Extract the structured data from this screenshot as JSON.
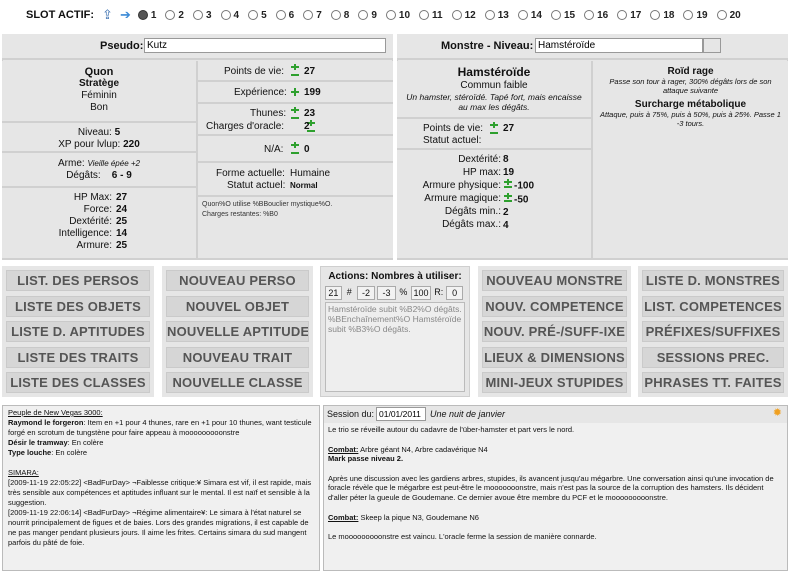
{
  "slotbar": {
    "label": "SLOT ACTIF:",
    "upload_icon": "upload-icon",
    "next_icon": "arrow-right-icon",
    "slots": [
      "1",
      "2",
      "3",
      "4",
      "5",
      "6",
      "7",
      "8",
      "9",
      "10",
      "11",
      "12",
      "13",
      "14",
      "15",
      "16",
      "17",
      "18",
      "19",
      "20"
    ],
    "active_slot": "1"
  },
  "player": {
    "pseudo_label": "Pseudo:",
    "pseudo_value": "Kutz",
    "name": "Quon",
    "class": "Stratège",
    "gender": "Féminin",
    "alignment": "Bon",
    "niveau_label": "Niveau:",
    "niveau": "5",
    "xp_label": "XP pour lvlup:",
    "xp": "220",
    "arme_label": "Arme:",
    "arme": "Vieille épée +2",
    "degats_label": "Dégâts:",
    "degats": "6 - 9",
    "hpmax_label": "HP Max:",
    "hpmax": "27",
    "force_label": "Force:",
    "force": "24",
    "dexterite_label": "Dextérité:",
    "dexterite": "25",
    "intelligence_label": "Intelligence:",
    "intelligence": "14",
    "armure_label": "Armure:",
    "armure": "25",
    "pv_label": "Points de vie:",
    "pv": "27",
    "exp_label": "Expérience:",
    "exp": "199",
    "thunes_label": "Thunes:",
    "thunes": "23",
    "charges_label": "Charges d'oracle:",
    "charges": "2",
    "na_label": "N/A:",
    "na": "0",
    "forme_label": "Forme actuelle:",
    "forme": "Humaine",
    "statut_label": "Statut actuel:",
    "statut": "Normal",
    "note1": "Quon%O utilise %BBouclier mystique%O.",
    "note2": "Charges restantes: %B0"
  },
  "monster": {
    "label": "Monstre - Niveau:",
    "value": "Hamstéroïde",
    "name": "Hamstéroïde",
    "rank": "Commun faible",
    "desc": "Un hamster, stéroïdé. Tapé fort, mais encaisse au max les dégâts.",
    "pv_label": "Points de vie:",
    "pv": "27",
    "statut_label": "Statut actuel:",
    "dexterite_label": "Dextérité:",
    "dexterite": "8",
    "hpmax_label": "HP max:",
    "hpmax": "19",
    "armphys_label": "Armure physique:",
    "armphys": "-100",
    "armmag_label": "Armure magique:",
    "armmag": "-50",
    "degmin_label": "Dégâts min.:",
    "degmin": "2",
    "degmax_label": "Dégâts max.:",
    "degmax": "4",
    "skill1_title": "Roïd rage",
    "skill1_desc": "Passe son tour à rager, 300% dégâts lors de son attaque suivante",
    "skill2_title": "Surcharge métabolique",
    "skill2_desc": "Attaque, puis à 75%, puis à 50%, puis à 25%. Passe 1 -3 tours."
  },
  "nav": {
    "col1": [
      "LIST. DES PERSOS",
      "LISTE DES OBJETS",
      "LISTE D. APTITUDES",
      "LISTE DES TRAITS",
      "LISTE DES CLASSES"
    ],
    "col2": [
      "NOUVEAU PERSO",
      "NOUVEL OBJET",
      "NOUVELLE APTITUDE",
      "NOUVEAU TRAIT",
      "NOUVELLE CLASSE"
    ],
    "col4": [
      "NOUVEAU MONSTRE",
      "NOUV. COMPETENCE",
      "NOUV. PRÉ-/SUFF-IXE",
      "LIEUX & DIMENSIONS",
      "MINI-JEUX STUPIDES"
    ],
    "col5": [
      "LISTE D. MONSTRES",
      "LIST. COMPETENCES",
      "PRÉFIXES/SUFFIXES",
      "SESSIONS PREC.",
      "PHRASES TT. FAITES"
    ]
  },
  "actions": {
    "title": "Actions: Nombres à utiliser:",
    "numbers": [
      "21",
      "#",
      "-2",
      "-3",
      "%",
      "100",
      "R:",
      "0"
    ],
    "text": "Hamstéroïde subit %B2%O dégâts. %BEnchaînement%O Hamstéroïde subit %B3%O dégâts."
  },
  "left_log": {
    "heading": "Peuple de New Vegas 3000:",
    "l1_b": "Raymond le forgeron",
    "l1": ": Item en +1 pour 4 thunes, rare en +1 pour 10 thunes, want testicule forgé en scrotum de tungstène pour faire appeau à mooooooooonstre",
    "l2_b": "Désir le tramway",
    "l2": ": En colère",
    "l3_b": "Type louche",
    "l3": ": En colère",
    "sima": "SIMARA:",
    "s1": "[2009-11-19 22:05:22] <BadFurDay> ¬Faiblesse critique:¥ Simara est vif, il est rapide, mais très sensible aux compétences et aptitudes influant sur le mental. Il est naïf et sensible à la suggestion.",
    "s2": "[2009-11-19 22:06:14] <BadFurDay> ¬Régime alimentaire¥: Le simara à  l'état naturel se nourrit principalement de figues et de baies. Lors des grandes migrations, il est capable de ne pas manger pendant plusieurs jours. Il aime les frites. Certains simara du sud mangent parfois du pâté de foie."
  },
  "session": {
    "label": "Session du:",
    "date": "01/01/2011",
    "subtitle": "Une nuit de janvier",
    "sun_icon": "sun-icon",
    "p1": "Le trio se réveille autour du cadavre de l'über-hamster et part vers le nord.",
    "combat1_label": "Combat:",
    "combat1": " Arbre géant N4, Arbre cadavérique N4",
    "mark": "Mark passe niveau 2.",
    "p2": "Après une discussion avec les gardiens arbres, stupides, ils avancent jusqu'au mégarbre. Une conversation ainsi qu'une invocation de foracle révèle que le mégarbre est peut-être le mooooooonstre, mais n'est pas la source de la corruption des hamsters. Ils décident d'aller péter la gueule de Goudemane. Ce dernier avoue être membre du PCF et le mooooooooonstre.",
    "combat2_label": "Combat:",
    "combat2": " Skeep la pique N3, Goudemane N6",
    "p3": "Le mooooooooonstre est vaincu. L'oracle ferme la session de manière connarde."
  }
}
